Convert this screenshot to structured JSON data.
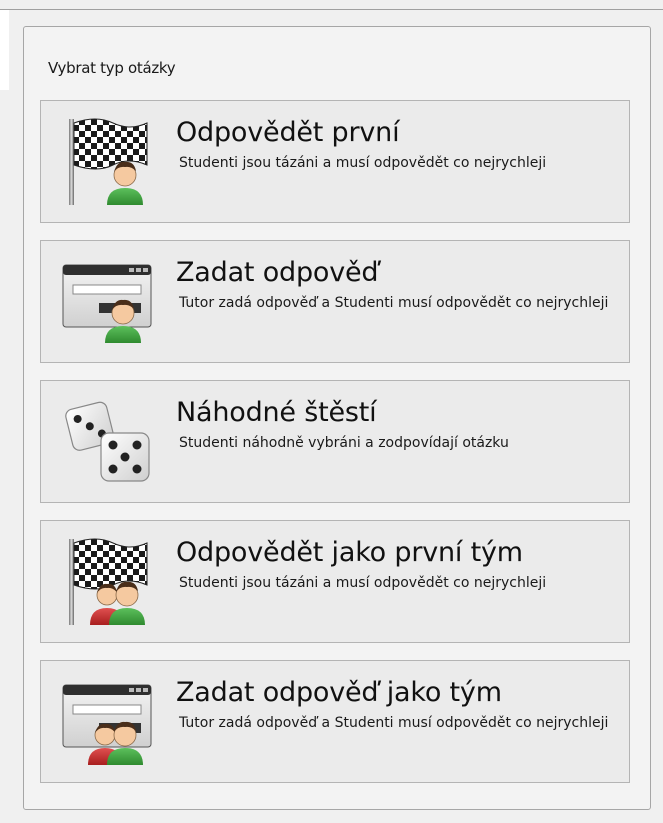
{
  "panel": {
    "title": "Vybrat typ otázky"
  },
  "options": [
    {
      "title": "Odpovědět první",
      "description": "Studenti jsou tázáni a musí odpovědět co nejrychleji",
      "icon": "checkered-flag-student-icon"
    },
    {
      "title": "Zadat odpověď",
      "description": "Tutor zadá odpověď a Studenti musí odpovědět co nejrychleji",
      "icon": "answer-window-student-icon"
    },
    {
      "title": "Náhodné štěstí",
      "description": "Studenti náhodně vybráni a zodpovídají otázku",
      "icon": "dice-icon"
    },
    {
      "title": "Odpovědět jako první tým",
      "description": "Studenti jsou tázáni a musí odpovědět co nejrychleji",
      "icon": "checkered-flag-team-icon"
    },
    {
      "title": "Zadat odpověď jako tým",
      "description": "Tutor zadá odpověď a Studenti musí odpovědět co nejrychleji",
      "icon": "answer-window-team-icon"
    }
  ],
  "colors": {
    "student_shirt": "#3ea33e",
    "team_shirt_red": "#cc2a2a",
    "window_header": "#2f2f2f"
  }
}
